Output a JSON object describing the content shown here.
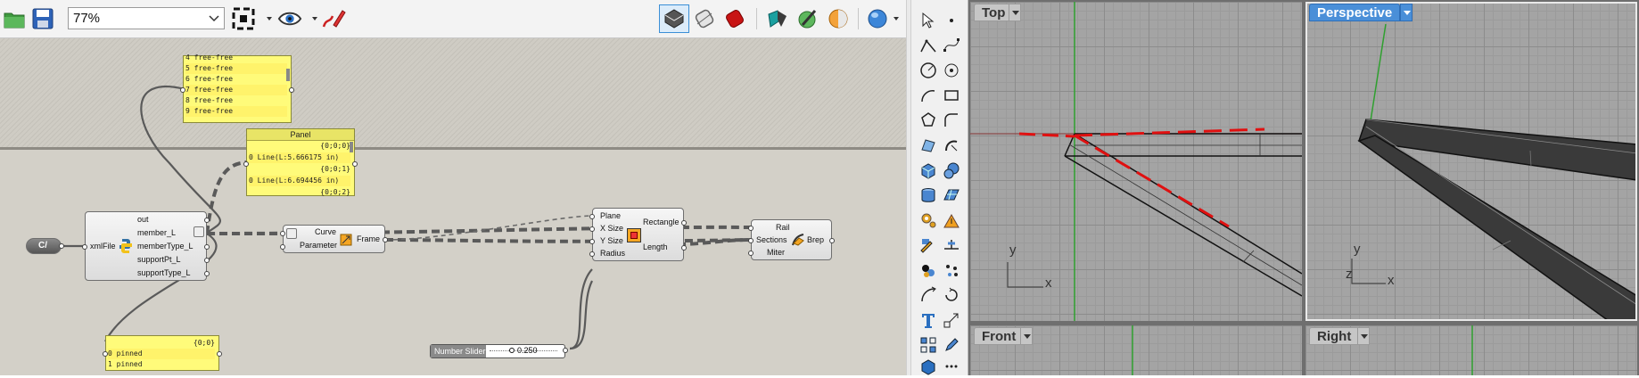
{
  "toolbar": {
    "zoom_value": "77%",
    "icons": [
      "open-file-icon",
      "save-file-icon",
      "zoom-extents-icon",
      "preview-eye-icon",
      "sketch-pen-icon",
      "preview-shaded-icon",
      "preview-wireframe-icon",
      "preview-red-icon",
      "bake-icon",
      "gumball-icon",
      "material-ball-icon",
      "render-sphere-icon"
    ]
  },
  "canvas": {
    "panel_top": {
      "rows": [
        {
          "idx": "4",
          "text": "free-free"
        },
        {
          "idx": "5",
          "text": "free-free"
        },
        {
          "idx": "6",
          "text": "free-free"
        },
        {
          "idx": "7",
          "text": "free-free"
        },
        {
          "idx": "8",
          "text": "free-free"
        },
        {
          "idx": "9",
          "text": "free-free"
        }
      ]
    },
    "panel_lines": {
      "title": "Panel",
      "path0": "{0;0;0}",
      "row0": "0 Line(L:5.666175 in)",
      "path1": "{0;0;1}",
      "row1": "0 Line(L:6.694456 in)",
      "path2": "{0;0;2}"
    },
    "panel_support": {
      "path": "{0;0}",
      "rows": [
        {
          "idx": "0",
          "text": "pinned"
        },
        {
          "idx": "1",
          "text": "pinned"
        }
      ]
    },
    "cf_component": {
      "label": "C/"
    },
    "python": {
      "input": "xmlFile",
      "outputs": [
        "out",
        "member_L",
        "memberType_L",
        "supportPt_L",
        "supportType_L"
      ]
    },
    "frame": {
      "inputs": [
        "Curve",
        "Parameter"
      ],
      "output": "Frame"
    },
    "rectangle": {
      "inputs": [
        "Plane",
        "X Size",
        "Y Size",
        "Radius"
      ],
      "outputs": [
        "Rectangle",
        "Length"
      ]
    },
    "sweep": {
      "inputs": [
        "Rail",
        "Sections",
        "Miter"
      ],
      "output": "Brep"
    },
    "slider": {
      "label": "Number Slider",
      "value": "0.250"
    }
  },
  "rhino": {
    "viewports": {
      "top": {
        "name": "Top"
      },
      "perspective": {
        "name": "Perspective"
      },
      "front": {
        "name": "Front"
      },
      "right": {
        "name": "Right"
      }
    },
    "axes": {
      "x": "x",
      "y": "y",
      "z": "z"
    },
    "tools": [
      "select-arrow-icon",
      "point-icon",
      "polyline-icon",
      "curve-points-icon",
      "circle-icon",
      "circle-center-icon",
      "arc-icon",
      "rectangle-icon",
      "polygon-icon",
      "fillet-icon",
      "surface-corner-icon",
      "revolve-icon",
      "box-icon",
      "sphere-icon",
      "cylinder-icon",
      "mesh-plane-icon",
      "gear-settings-icon",
      "explode-icon",
      "boolean-icon",
      "dimension-icon",
      "group-icon",
      "join-icon",
      "text-icon",
      "scale-icon",
      "transform-icon",
      "edit-icon",
      "solid-box-icon",
      "dots-icon"
    ]
  },
  "colors": {
    "canvas": "#d3d0c8",
    "panel": "#fffb7a",
    "viewport_active": "#4a8fd8",
    "x_axis": "#a33a3a",
    "y_axis": "#3aa13a",
    "selection_red": "#e01010"
  }
}
